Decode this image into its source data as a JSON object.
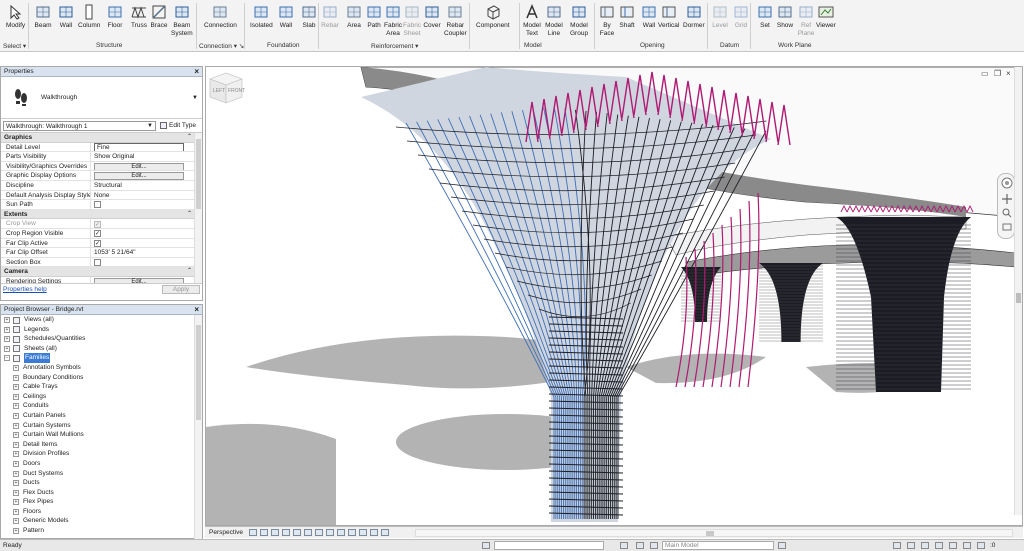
{
  "ribbon": {
    "tools": [
      {
        "id": "modify",
        "label": "Modify",
        "icon": "modify-cursor-icon"
      },
      {
        "id": "beam",
        "label": "Beam",
        "icon": "beam-icon"
      },
      {
        "id": "wall",
        "label": "Wall",
        "icon": "wall-icon"
      },
      {
        "id": "column",
        "label": "Column",
        "icon": "column-icon"
      },
      {
        "id": "floor",
        "label": "Floor",
        "icon": "floor-icon"
      },
      {
        "id": "truss",
        "label": "Truss",
        "icon": "truss-icon"
      },
      {
        "id": "brace",
        "label": "Brace",
        "icon": "brace-icon"
      },
      {
        "id": "beam_system",
        "label": "Beam\nSystem",
        "icon": "beam-system-icon"
      },
      {
        "id": "connection",
        "label": "Connection",
        "icon": "connection-icon"
      },
      {
        "id": "isolated",
        "label": "Isolated",
        "icon": "isolated-foundation-icon"
      },
      {
        "id": "wall_found",
        "label": "Wall",
        "icon": "wall-foundation-icon"
      },
      {
        "id": "slab",
        "label": "Slab",
        "icon": "slab-icon"
      },
      {
        "id": "rebar",
        "label": "Rebar",
        "icon": "rebar-icon",
        "disabled": true
      },
      {
        "id": "area",
        "label": "Area",
        "icon": "area-reinforcement-icon"
      },
      {
        "id": "path",
        "label": "Path",
        "icon": "path-reinforcement-icon"
      },
      {
        "id": "fabric_area",
        "label": "Fabric\nArea",
        "icon": "fabric-area-icon"
      },
      {
        "id": "fabric_sheet",
        "label": "Fabric\nSheet",
        "icon": "fabric-sheet-icon",
        "disabled": true
      },
      {
        "id": "cover",
        "label": "Cover",
        "icon": "cover-icon"
      },
      {
        "id": "rebar_coupler",
        "label": "Rebar\nCoupler",
        "icon": "rebar-coupler-icon"
      },
      {
        "id": "component",
        "label": "Component",
        "icon": "component-icon"
      },
      {
        "id": "model_text",
        "label": "Model\nText",
        "icon": "model-text-icon"
      },
      {
        "id": "model_line",
        "label": "Model\nLine",
        "icon": "model-line-icon"
      },
      {
        "id": "model_group",
        "label": "Model\nGroup",
        "icon": "model-group-icon"
      },
      {
        "id": "by_face",
        "label": "By\nFace",
        "icon": "by-face-icon"
      },
      {
        "id": "shaft",
        "label": "Shaft",
        "icon": "shaft-icon"
      },
      {
        "id": "wall_opening",
        "label": "Wall",
        "icon": "wall-opening-icon"
      },
      {
        "id": "vertical",
        "label": "Vertical",
        "icon": "vertical-opening-icon"
      },
      {
        "id": "dormer",
        "label": "Dormer",
        "icon": "dormer-icon"
      },
      {
        "id": "level",
        "label": "Level",
        "icon": "level-icon",
        "disabled": true
      },
      {
        "id": "grid",
        "label": "Grid",
        "icon": "grid-icon",
        "disabled": true
      },
      {
        "id": "set",
        "label": "Set",
        "icon": "set-workplane-icon"
      },
      {
        "id": "show",
        "label": "Show",
        "icon": "show-workplane-icon"
      },
      {
        "id": "ref_plane",
        "label": "Ref\nPlane",
        "icon": "ref-plane-icon",
        "disabled": true
      },
      {
        "id": "viewer",
        "label": "Viewer",
        "icon": "viewer-icon"
      }
    ],
    "panels": {
      "select": "Select ▾",
      "structure": "Structure",
      "connection": "Connection ▾ ↘",
      "foundation": "Foundation",
      "reinforcement": "Reinforcement ▾",
      "model": "Model",
      "opening": "Opening",
      "datum": "Datum",
      "work_plane": "Work Plane"
    }
  },
  "properties": {
    "title": "Properties",
    "type_name": "Walkthrough",
    "instance_selector": "Walkthrough: Walkthrough 1",
    "edit_type": "Edit Type",
    "groups": [
      {
        "name": "Graphics",
        "rows": [
          {
            "key": "Detail Level",
            "value": "Fine",
            "kind": "input"
          },
          {
            "key": "Parts Visibility",
            "value": "Show Original",
            "kind": "text"
          },
          {
            "key": "Visibility/Graphics Overrides",
            "value": "Edit...",
            "kind": "button"
          },
          {
            "key": "Graphic Display Options",
            "value": "Edit...",
            "kind": "button"
          },
          {
            "key": "Discipline",
            "value": "Structural",
            "kind": "text"
          },
          {
            "key": "Default Analysis Display Style",
            "value": "None",
            "kind": "text"
          },
          {
            "key": "Sun Path",
            "value": "",
            "kind": "check",
            "checked": false
          }
        ]
      },
      {
        "name": "Extents",
        "rows": [
          {
            "key": "Crop View",
            "value": "✓",
            "kind": "check",
            "checked": true,
            "dim": true
          },
          {
            "key": "Crop Region Visible",
            "value": "✓",
            "kind": "check",
            "checked": true
          },
          {
            "key": "Far Clip Active",
            "value": "✓",
            "kind": "check",
            "checked": true
          },
          {
            "key": "Far Clip Offset",
            "value": "1053'  5 21/64\"",
            "kind": "text"
          },
          {
            "key": "Section Box",
            "value": "",
            "kind": "check",
            "checked": false
          }
        ]
      },
      {
        "name": "Camera",
        "rows": [
          {
            "key": "Rendering Settings",
            "value": "Edit...",
            "kind": "button"
          },
          {
            "key": "Locked Orientation",
            "value": "",
            "kind": "check",
            "checked": false,
            "dim": true
          }
        ]
      }
    ],
    "help_link": "Properties help",
    "apply": "Apply"
  },
  "browser": {
    "title": "Project Browser - Bridge.rvt",
    "items": [
      {
        "label": "Views (all)",
        "depth": 0,
        "icon": "views-icon"
      },
      {
        "label": "Legends",
        "depth": 0,
        "icon": "legends-icon"
      },
      {
        "label": "Schedules/Quantities",
        "depth": 0,
        "icon": "schedules-icon"
      },
      {
        "label": "Sheets (all)",
        "depth": 0,
        "icon": "sheets-icon"
      },
      {
        "label": "Families",
        "depth": 0,
        "icon": "families-icon",
        "expanded": true,
        "selected": true
      },
      {
        "label": "Annotation Symbols",
        "depth": 1
      },
      {
        "label": "Boundary Conditions",
        "depth": 1
      },
      {
        "label": "Cable Trays",
        "depth": 1
      },
      {
        "label": "Ceilings",
        "depth": 1
      },
      {
        "label": "Conduits",
        "depth": 1
      },
      {
        "label": "Curtain Panels",
        "depth": 1
      },
      {
        "label": "Curtain Systems",
        "depth": 1
      },
      {
        "label": "Curtain Wall Mullions",
        "depth": 1
      },
      {
        "label": "Detail Items",
        "depth": 1
      },
      {
        "label": "Division Profiles",
        "depth": 1
      },
      {
        "label": "Doors",
        "depth": 1
      },
      {
        "label": "Duct Systems",
        "depth": 1
      },
      {
        "label": "Ducts",
        "depth": 1
      },
      {
        "label": "Flex Ducts",
        "depth": 1
      },
      {
        "label": "Flex Pipes",
        "depth": 1
      },
      {
        "label": "Floors",
        "depth": 1
      },
      {
        "label": "Generic Models",
        "depth": 1
      },
      {
        "label": "Pattern",
        "depth": 1
      }
    ]
  },
  "viewport": {
    "viewcube_left": "LEFT",
    "viewcube_front": "FRONT"
  },
  "view_control": {
    "scale": "Perspective"
  },
  "status": {
    "ready": "Ready",
    "workset": "",
    "model": "Main Model",
    "filter_count": ":0"
  },
  "colors": {
    "rebar_magenta": "#b01a73",
    "rebar_blue": "#3f6fb8",
    "rebar_dark": "#1c1c24",
    "deck_shadow": "#8a8a8a",
    "ground_shadow": "#b3b3b3"
  }
}
